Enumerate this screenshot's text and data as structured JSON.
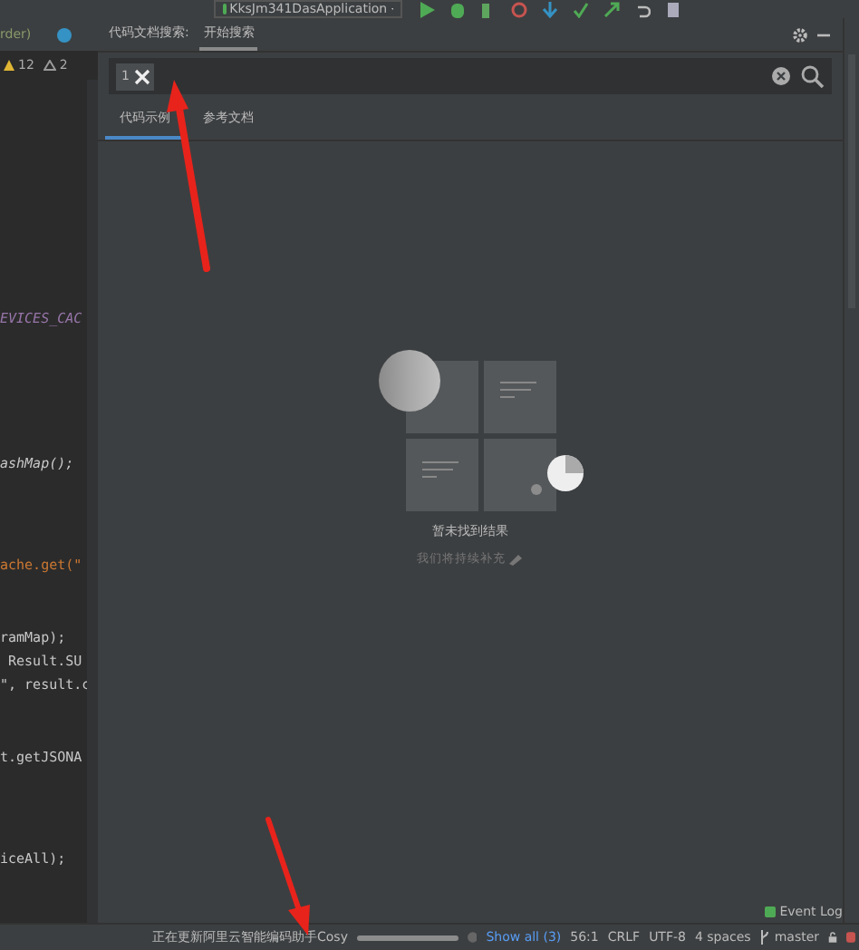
{
  "toolbar": {
    "run_config": "KksJm341DasApplication"
  },
  "editor": {
    "breadcrumb": "rder)",
    "warnings": "12",
    "weak_warnings": "2",
    "code_lines": [
      {
        "text": "EVICES_CAC",
        "kind": "constant"
      },
      {
        "text": "ashMap();",
        "kind": "call"
      },
      {
        "text": "ache.get(\"",
        "kind": "field-call"
      },
      {
        "text": "ramMap);",
        "kind": "plain"
      },
      {
        "text": " Result.SU",
        "kind": "result"
      },
      {
        "text": "\", result.c",
        "kind": "plain"
      },
      {
        "text": "t.getJSONA",
        "kind": "plain"
      },
      {
        "text": "iceAll);",
        "kind": "plain"
      }
    ]
  },
  "tool_window": {
    "tabs": [
      {
        "label": "代码文档搜索:",
        "selected": false
      },
      {
        "label": "开始搜索",
        "selected": true
      }
    ],
    "search": {
      "chip": "1"
    },
    "result_tabs": [
      {
        "label": "代码示例",
        "selected": true
      },
      {
        "label": "参考文档",
        "selected": false
      }
    ],
    "empty_state": {
      "title": "暂未找到结果",
      "subtitle": "我们将持续补充"
    }
  },
  "status_bar": {
    "event_log": "Event Log",
    "message": "正在更新阿里云智能编码助手Cosy",
    "show_all": "Show all (3)",
    "position": "56:1",
    "line_separator": "CRLF",
    "encoding": "UTF-8",
    "indent": "4 spaces",
    "branch": "master"
  }
}
